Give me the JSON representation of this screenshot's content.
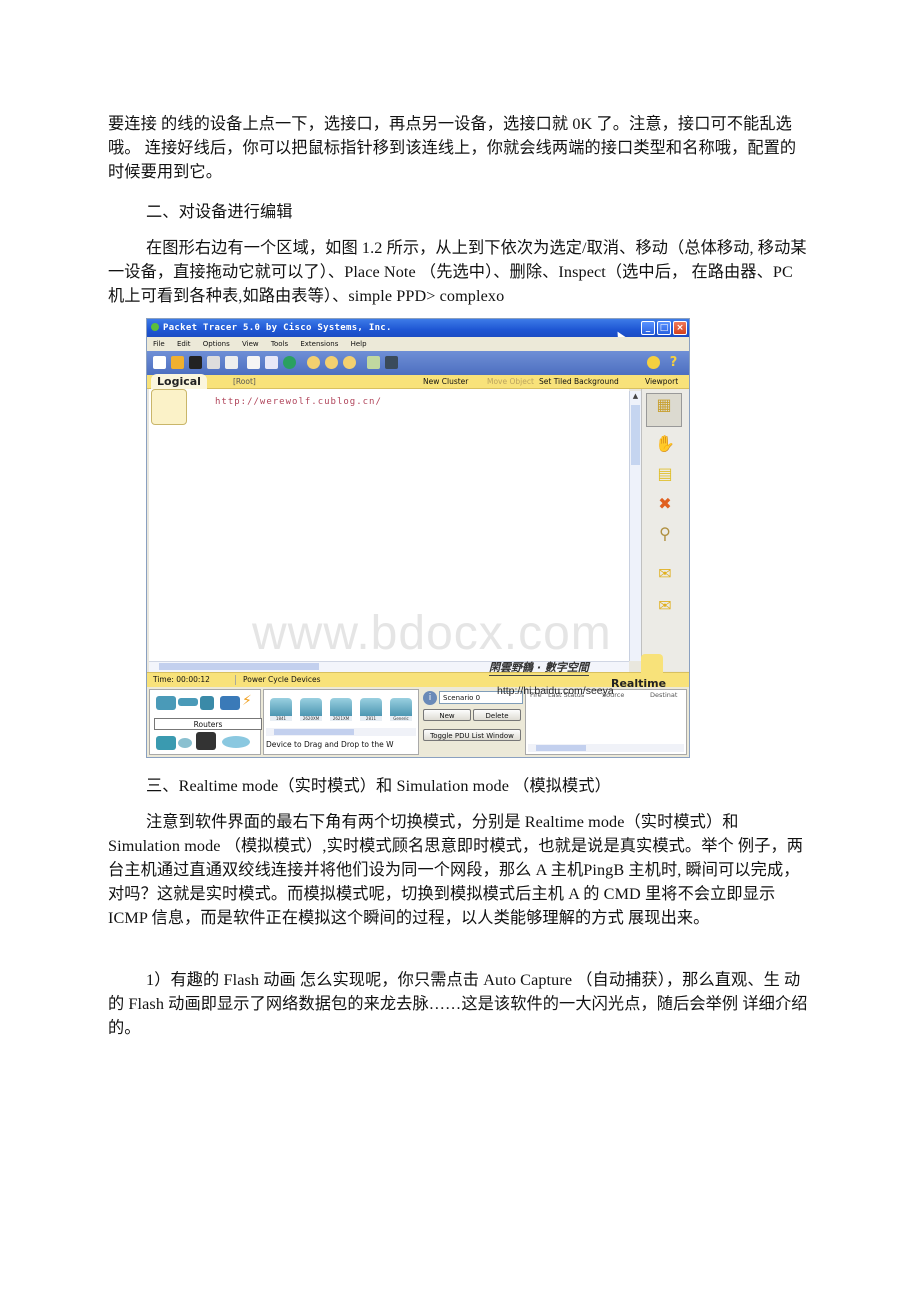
{
  "document": {
    "para1": "要连接 的线的设备上点一下，选接口，再点另一设备，选接口就 0K 了。注意，接口可不能乱选哦。 连接好线后，你可以把鼠标指针移到该连线上，你就会线两端的接口类型和名称哦，配置的 时候要用到它。",
    "heading2": "二、对设备进行编辑",
    "para2": "在图形右边有一个区域，如图 1.2 所示，从上到下依次为选定/取消、移动（总体移动, 移动某一设备，直接拖动它就可以了）、Place Note （先选中）、删除、Inspect（选中后， 在路由器、PC 机上可看到各种表,如路由表等）、simple PPD> complexo",
    "heading3": "三、Realtime mode（实时模式）和 Simulation mode （模拟模式）",
    "para3": "注意到软件界面的最右下角有两个切换模式，分别是 Realtime mode（实时模式）和 Simulation mode （模拟模式）,实时模式顾名思意即时模式，也就是说是真实模式。举个 例子，两台主机通过直通双绞线连接并将他们设为同一个网段，那么 A 主机PingB 主机时, 瞬间可以完成，对吗？这就是实时模式。而模拟模式呢，切换到模拟模式后主机 A 的 CMD 里将不会立即显示 ICMP 信息，而是软件正在模拟这个瞬间的过程，以人类能够理解的方式 展现出来。",
    "para4": "1）有趣的 Flash 动画 怎么实现呢，你只需点击 Auto Capture （自动捕获），那么直观、生 动的 Flash 动画即显示了网络数据包的来龙去脉……这是该软件的一大闪光点，随后会举例 详细介绍的。"
  },
  "screenshot": {
    "title": "Packet Tracer 5.0 by Cisco Systems, Inc.",
    "menu": [
      "File",
      "Edit",
      "Options",
      "View",
      "Tools",
      "Extensions",
      "Help"
    ],
    "workspace_bar": {
      "tab": "Logical",
      "root": "[Root]",
      "new_cluster": "New Cluster",
      "move_object": "Move Object",
      "set_tiled_background": "Set Tiled Background",
      "viewport": "Viewport"
    },
    "canvas_url": "http://werewolf.cublog.cn/",
    "status": {
      "time": "Time: 00:00:12",
      "power_cycle": "Power Cycle Devices",
      "mode": "Realtime"
    },
    "device_panel": {
      "category": "Routers",
      "models": [
        "1841",
        "2620XM",
        "2621XM",
        "2811",
        "Generic"
      ],
      "hint": "Device to Drag and Drop to the W"
    },
    "scenario": {
      "selected": "Scenario 0",
      "new": "New",
      "delete": "Delete",
      "toggle": "Toggle PDU List Window"
    },
    "pdu_columns": [
      "Fire",
      "Last Status",
      "Source",
      "Destinat"
    ],
    "signature": "閑雲野鶴 · 數字空間",
    "baidu_url": "http://hi.baidu.com/seeya"
  },
  "watermark": "www.bdocx.com"
}
